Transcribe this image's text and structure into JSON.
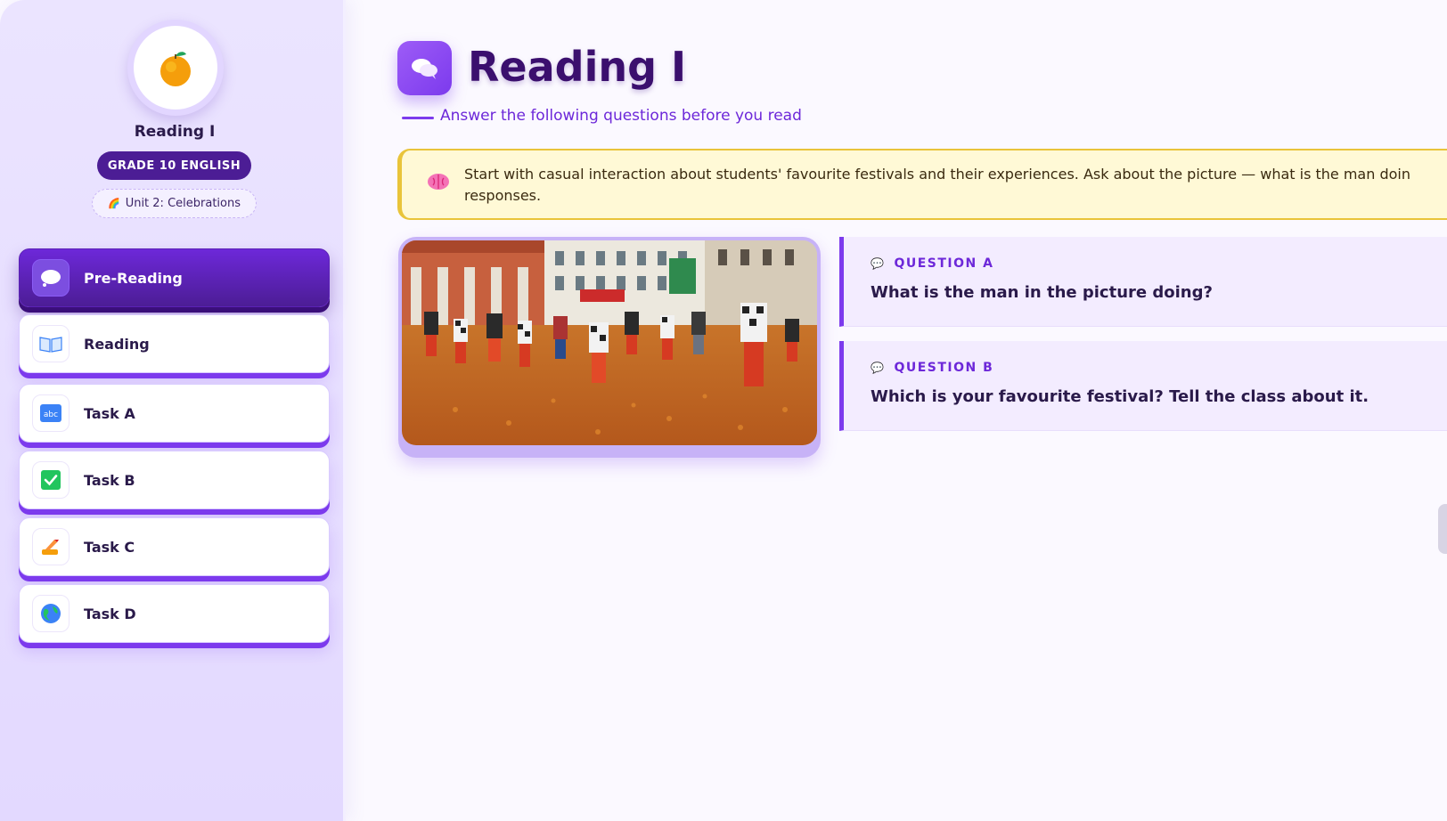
{
  "sidebar": {
    "avatar_icon": "orange-fruit-icon",
    "title": "Reading I",
    "grade_badge": "GRADE 10 ENGLISH",
    "unit_icon": "rainbow-people-icon",
    "unit_badge": "Unit 2: Celebrations",
    "nav": [
      {
        "label": "Pre-Reading",
        "icon": "thought-bubble-icon",
        "active": true
      },
      {
        "label": "Reading",
        "icon": "open-book-icon",
        "active": false
      },
      {
        "label": "Task A",
        "icon": "abc-icon",
        "active": false
      },
      {
        "label": "Task B",
        "icon": "check-box-icon",
        "active": false
      },
      {
        "label": "Task C",
        "icon": "writing-hand-icon",
        "active": false
      },
      {
        "label": "Task D",
        "icon": "globe-icon",
        "active": false
      }
    ]
  },
  "main": {
    "title_icon": "chat-bubbles-icon",
    "title": "Reading I",
    "subtitle": "Answer the following questions before you read",
    "notice": {
      "icon": "brain-icon",
      "text": "Start with casual interaction about students' favourite festivals and their experiences. Ask about the picture — what is the man doin\nresponses."
    },
    "photo": "festival-crowd-photo",
    "questions": [
      {
        "tag": "QUESTION A",
        "text": "What is the man in the picture doing?"
      },
      {
        "tag": "QUESTION B",
        "text": "Which is your favourite festival? Tell the class about it."
      }
    ]
  },
  "colors": {
    "accent": "#7c3aed",
    "accent_dark": "#4c1d95",
    "notice_bg": "#fff9d6",
    "notice_border": "#e9c43a"
  }
}
